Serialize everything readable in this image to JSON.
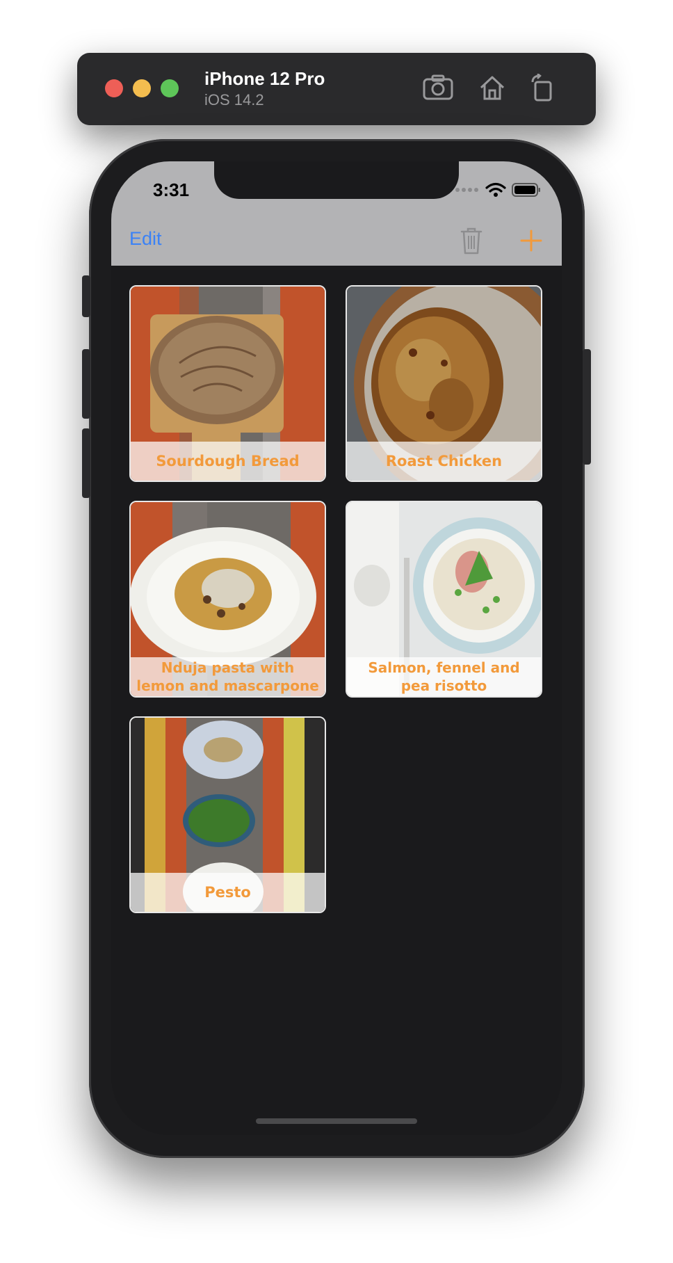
{
  "simulator": {
    "device_name": "iPhone 12 Pro",
    "os_version": "iOS 14.2",
    "toolbar_icons": [
      "screenshot-icon",
      "home-icon",
      "rotate-icon"
    ]
  },
  "status_bar": {
    "time": "3:31"
  },
  "nav_bar": {
    "edit_label": "Edit",
    "trash_icon": "trash-icon",
    "add_icon": "plus-icon"
  },
  "recipes": [
    {
      "title": "Sourdough Bread"
    },
    {
      "title": "Roast Chicken"
    },
    {
      "title": "Nduja pasta with lemon and mascarpone"
    },
    {
      "title": "Salmon, fennel and pea risotto"
    },
    {
      "title": "Pesto"
    }
  ],
  "colors": {
    "accent_blue": "#3b82f6",
    "accent_orange": "#f29a3b"
  }
}
